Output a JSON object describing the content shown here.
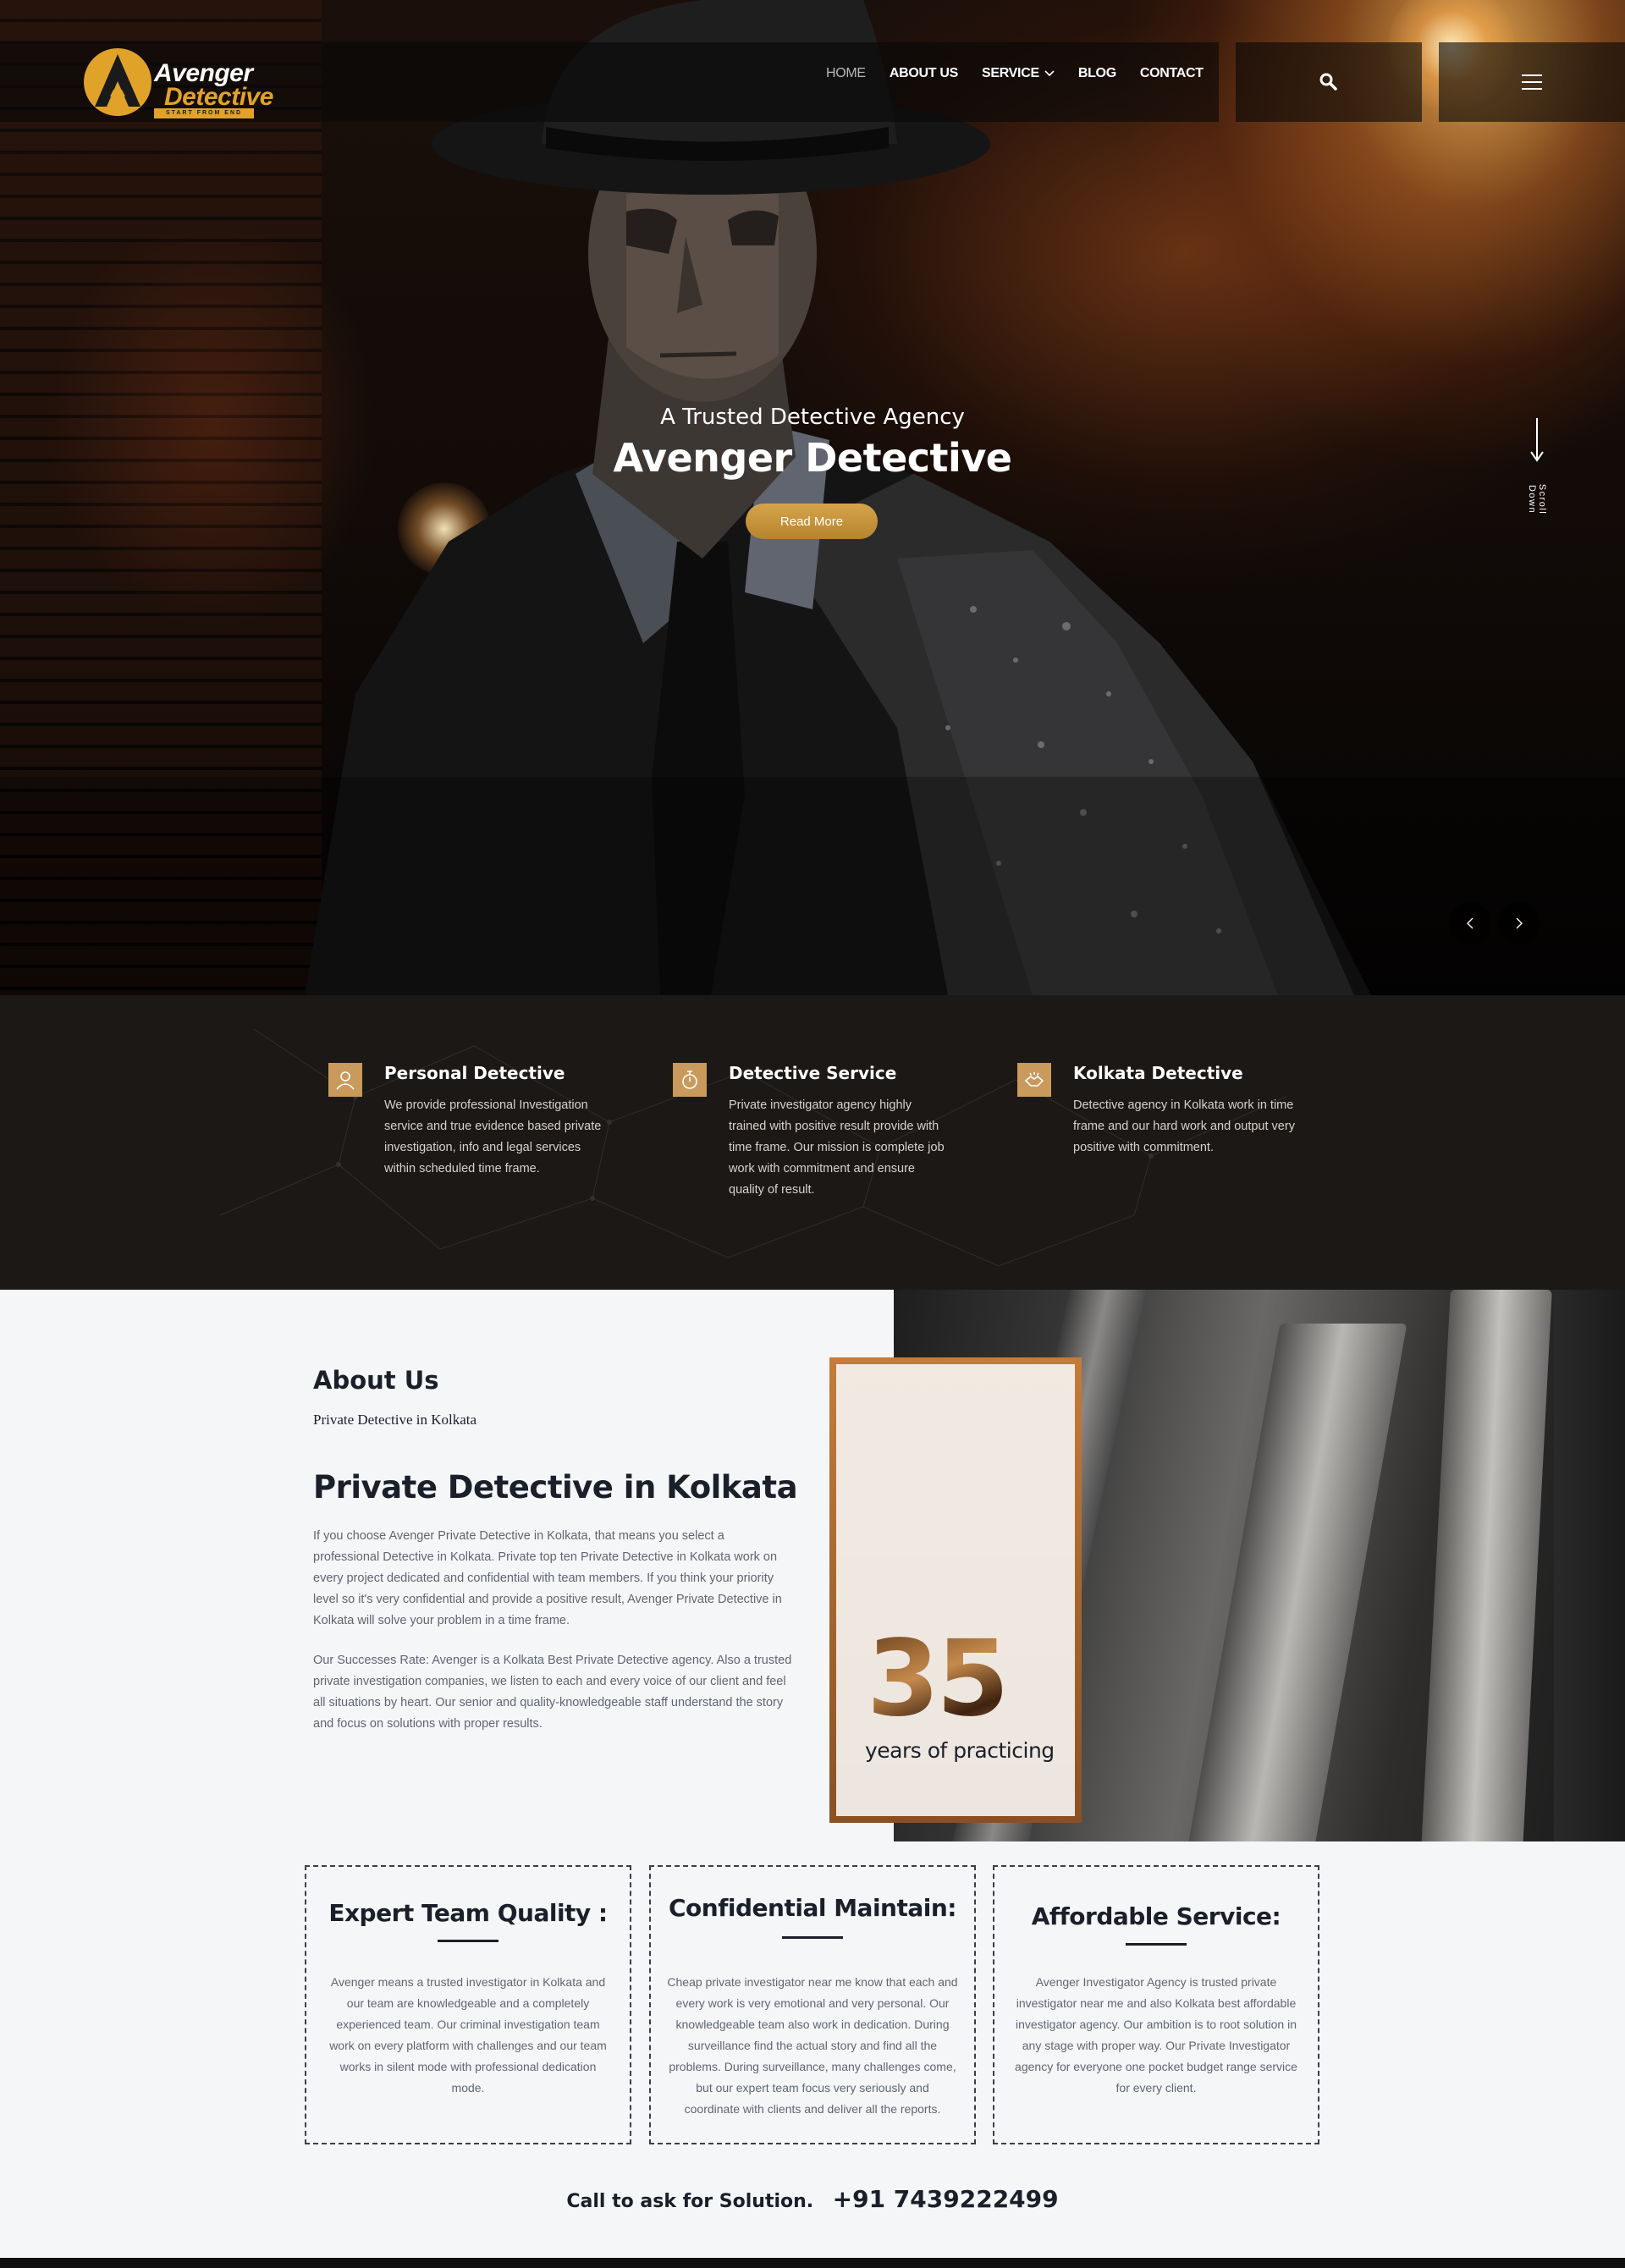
{
  "brand": {
    "name_line1": "Avenger",
    "name_line2": "Detective",
    "tagline": "START FROM END",
    "accent_color": "#e1a22a"
  },
  "nav": {
    "items": [
      {
        "label": "HOME",
        "active": true
      },
      {
        "label": "ABOUT US"
      },
      {
        "label": "SERVICE",
        "has_dropdown": true
      },
      {
        "label": "BLOG"
      },
      {
        "label": "CONTACT"
      }
    ],
    "search_icon": "search-icon",
    "menu_icon": "hamburger-menu-icon"
  },
  "hero": {
    "subtitle": "A Trusted Detective Agency",
    "title": "Avenger Detective",
    "button_label": "Read More",
    "scroll_label": "Scroll Down"
  },
  "services": [
    {
      "title": "Personal Detective",
      "icon": "person-icon",
      "text": [
        "We provide professional Investigation",
        "service and true evidence based private",
        "investigation, info and legal services",
        "within scheduled time frame."
      ]
    },
    {
      "title": "Detective Service",
      "icon": "stopwatch-icon",
      "text": [
        "Private investigator agency highly",
        "trained with positive result provide with",
        "time frame. Our mission is complete job",
        "work with commitment and ensure",
        "quality of result."
      ]
    },
    {
      "title": "Kolkata Detective",
      "icon": "handshake-icon",
      "text": [
        "Detective agency in Kolkata work in time",
        "frame and our hard work and output very",
        "positive with commitment."
      ]
    }
  ],
  "about": {
    "heading": "About Us",
    "subheading": "Private Detective in Kolkata",
    "title": "Private Detective in Kolkata",
    "paragraph1": [
      "If you choose Avenger Private Detective in Kolkata, that means you select a",
      "professional Detective in Kolkata. Private top ten Private Detective in Kolkata work on",
      "every project dedicated and confidential with team members. If you think your priority",
      "level so it's very confidential and provide a positive result, Avenger Private Detective in",
      "Kolkata will solve your problem in a time frame."
    ],
    "paragraph2": [
      "Our Successes Rate: Avenger is a Kolkata Best Private Detective agency. Also a trusted",
      "private investigation companies, we listen to each and every voice of our client and feel",
      "all situations by heart. Our senior and quality-knowledgeable staff understand the story",
      "and focus on solutions with proper results."
    ],
    "years_number": "35",
    "years_label": "years of practicing"
  },
  "features": [
    {
      "title": "Expert Team Quality :",
      "text": [
        "Avenger means a trusted investigator in Kolkata and",
        "our team are knowledgeable and a completely",
        "experienced team. Our criminal investigation team",
        "work on every platform with challenges and our team",
        "works in silent mode with professional dedication",
        "mode."
      ]
    },
    {
      "title": "Confidential Maintain:",
      "text": [
        "Cheap private investigator near me know that each and",
        "every work is very emotional and very personal. Our",
        "knowledgeable team also work in dedication. During",
        "surveillance find the actual story and find all the",
        "problems. During surveillance, many challenges come,",
        "but our expert team focus very seriously and",
        "coordinate with clients and deliver all the reports."
      ]
    },
    {
      "title": "Affordable Service:",
      "text": [
        "Avenger Investigator Agency is trusted private",
        "investigator near me and also Kolkata best affordable",
        "investigator agency. Our ambition is to root solution in",
        "any stage with proper way. Our Private Investigator",
        "agency for everyone one pocket budget range service",
        "for every client."
      ]
    }
  ],
  "cta": {
    "label": "Call to ask for Solution.",
    "phone": "+91 7439222499"
  }
}
